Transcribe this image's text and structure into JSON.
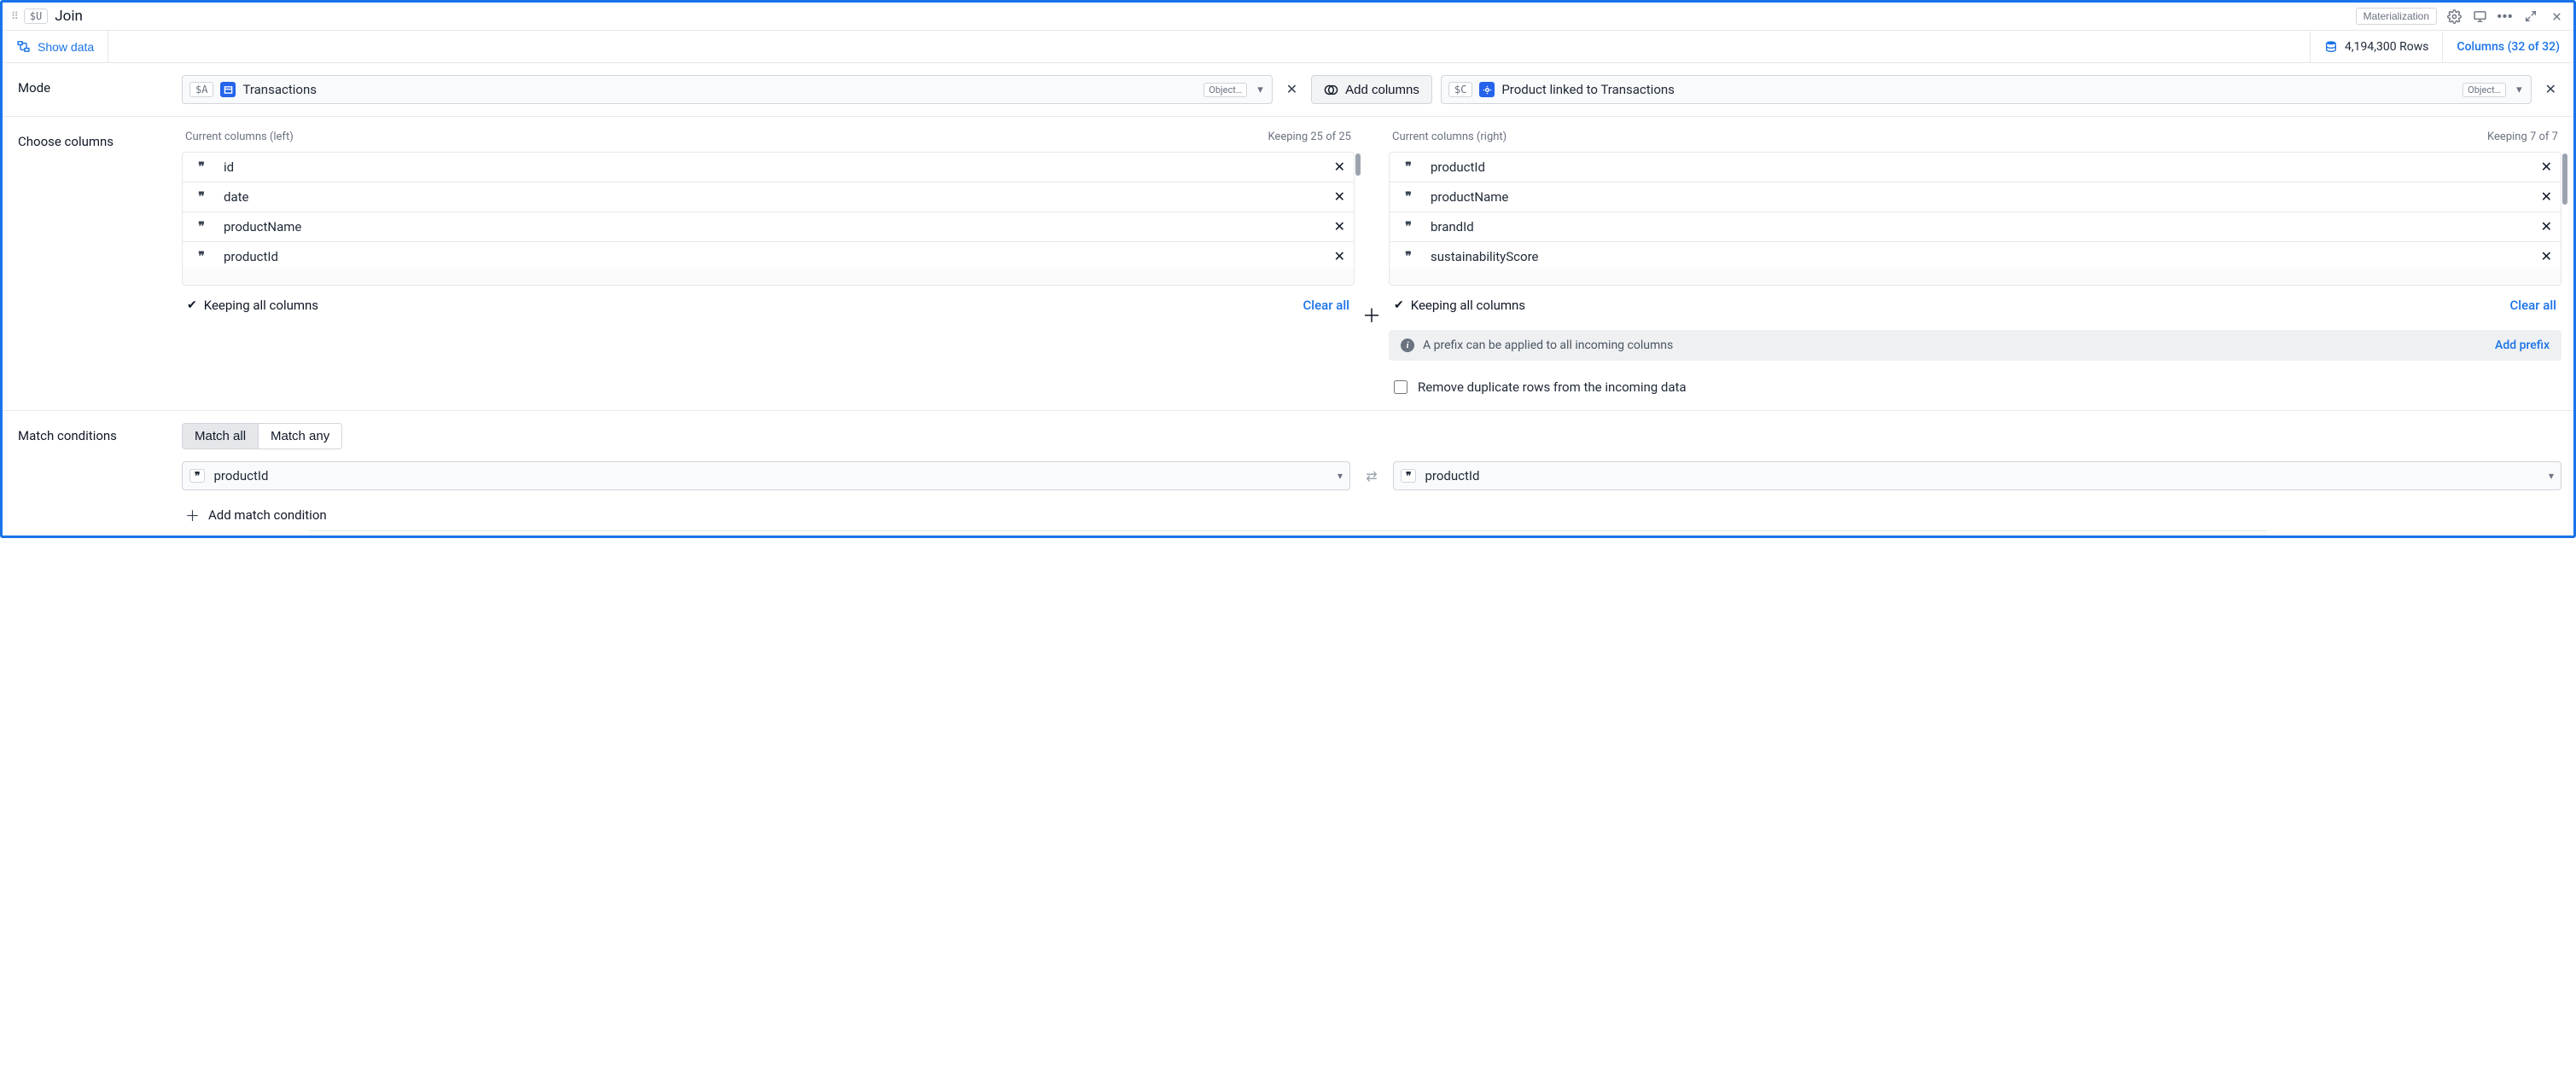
{
  "titlebar": {
    "tag": "$U",
    "title": "Join",
    "materialization_label": "Materialization"
  },
  "infobar": {
    "show_data_label": "Show data",
    "row_count": "4,194,300 Rows",
    "columns_label": "Columns (32 of 32)"
  },
  "mode": {
    "label": "Mode",
    "left": {
      "tag": "$A",
      "name": "Transactions",
      "object_tag": "Object…"
    },
    "add_columns_label": "Add columns",
    "right": {
      "tag": "$C",
      "name": "Product linked to Transactions",
      "object_tag": "Object…"
    }
  },
  "choose": {
    "label": "Choose columns",
    "left": {
      "heading": "Current columns (left)",
      "keeping": "Keeping 25 of 25",
      "columns": [
        "id",
        "date",
        "productName",
        "productId"
      ],
      "keeping_all_label": "Keeping all columns",
      "clear_label": "Clear all"
    },
    "right": {
      "heading": "Current columns (right)",
      "keeping": "Keeping 7 of 7",
      "columns": [
        "productId",
        "productName",
        "brandId",
        "sustainabilityScore"
      ],
      "keeping_all_label": "Keeping all columns",
      "clear_label": "Clear all"
    },
    "prefix": {
      "text": "A prefix can be applied to all incoming columns",
      "action": "Add prefix"
    },
    "dedupe_label": "Remove duplicate rows from the incoming data"
  },
  "match": {
    "label": "Match conditions",
    "match_all": "Match all",
    "match_any": "Match any",
    "left_col": "productId",
    "right_col": "productId",
    "add_label": "Add match condition"
  }
}
